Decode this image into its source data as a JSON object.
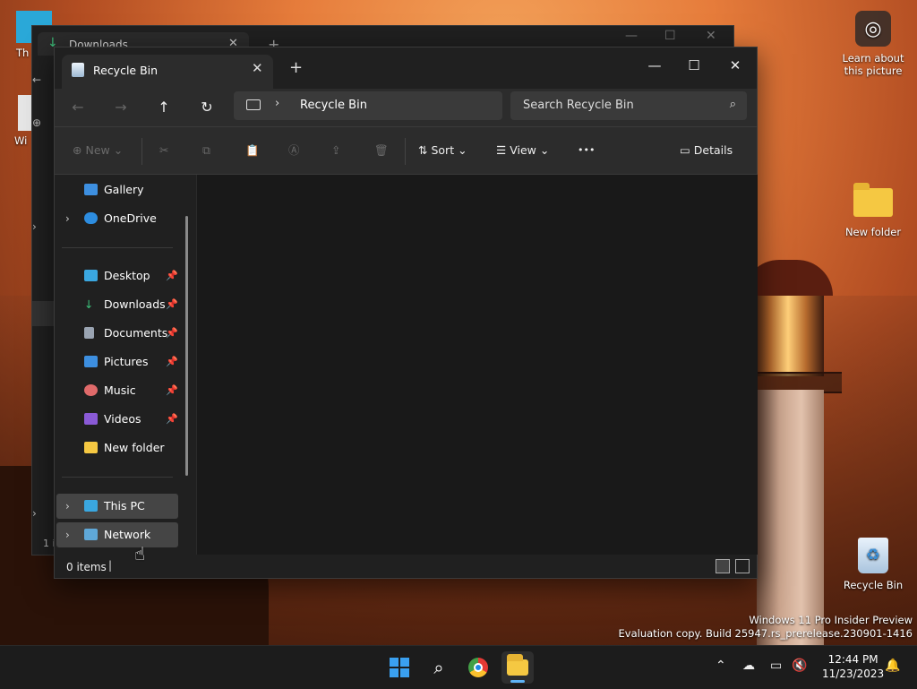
{
  "desktop": {
    "lens_label_line1": "Learn about",
    "lens_label_line2": "this picture",
    "new_folder_label": "New folder",
    "recycle_bin_label": "Recycle Bin",
    "left_clip_1": "Th",
    "left_clip_2": "Wi",
    "watermark_line1": "Windows 11 Pro Insider Preview",
    "watermark_line2": "Evaluation copy. Build 25947.rs_prerelease.230901-1416"
  },
  "back_window": {
    "tab_label": "Downloads",
    "status_clip": "1 i"
  },
  "window": {
    "tab_label": "Recycle Bin",
    "address_text": "Recycle Bin",
    "search_placeholder": "Search Recycle Bin",
    "toolbar": {
      "new_label": "New",
      "sort_label": "Sort",
      "view_label": "View",
      "more_label": "•••",
      "details_label": "Details"
    },
    "sidebar": {
      "top_items": [
        {
          "label": "Gallery"
        },
        {
          "label": "OneDrive"
        }
      ],
      "pinned_items": [
        {
          "label": "Desktop"
        },
        {
          "label": "Downloads"
        },
        {
          "label": "Documents"
        },
        {
          "label": "Pictures"
        },
        {
          "label": "Music"
        },
        {
          "label": "Videos"
        },
        {
          "label": "New folder"
        }
      ],
      "bottom_items": [
        {
          "label": "This PC"
        },
        {
          "label": "Network"
        }
      ]
    },
    "status_text": "0 items"
  },
  "taskbar": {
    "time": "12:44 PM",
    "date": "11/23/2023"
  },
  "colors": {
    "accent": "#5eb3f6",
    "window_bg": "#191919",
    "toolbar_bg": "#2c2c2c"
  }
}
